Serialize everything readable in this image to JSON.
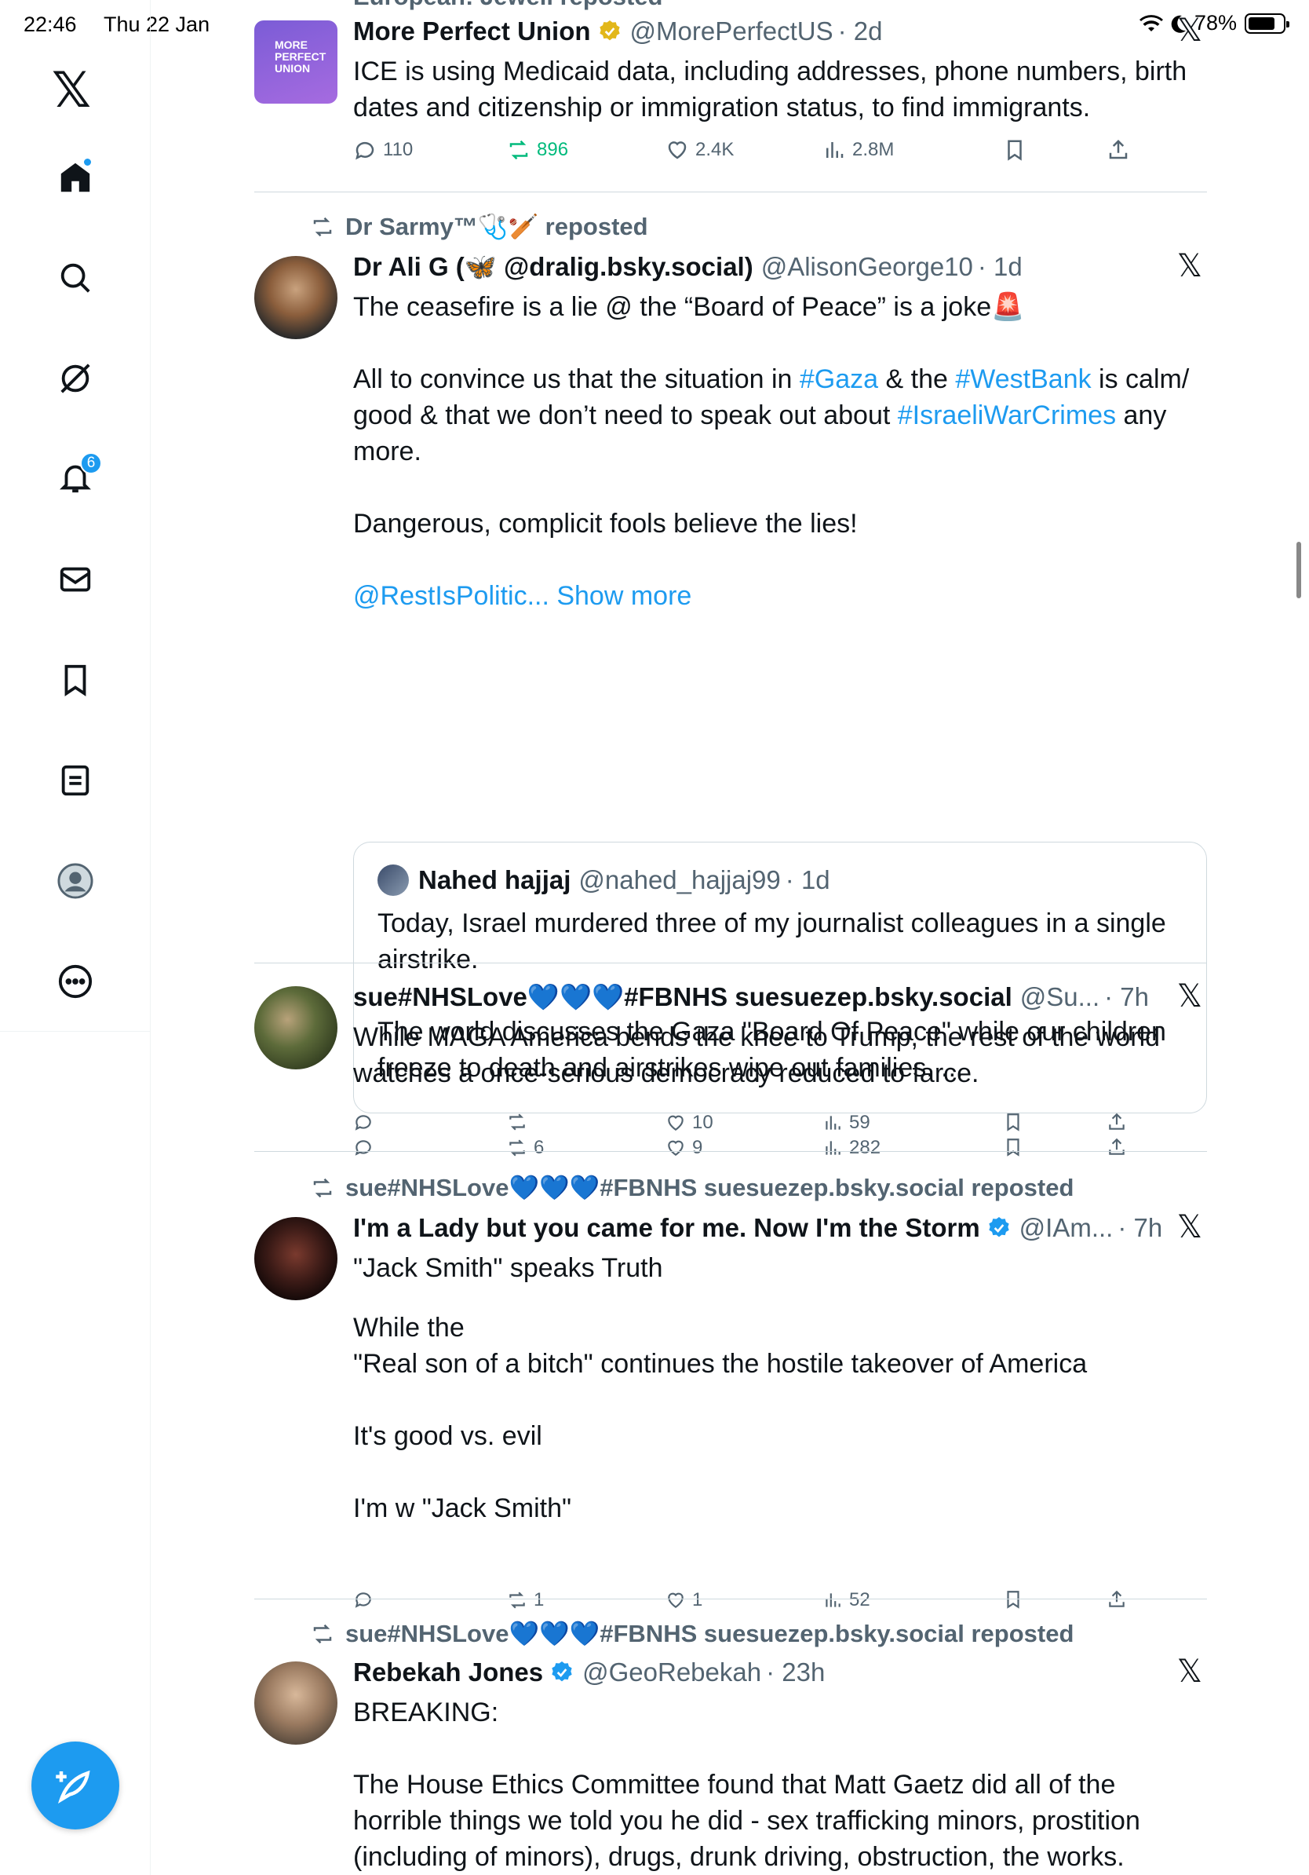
{
  "status": {
    "time": "22:46",
    "date": "Thu 22 Jan",
    "battery": "78%"
  },
  "sidebar": {
    "logo": "𝕏",
    "items": [
      {
        "name": "home",
        "icon": "home-icon"
      },
      {
        "name": "explore",
        "icon": "search-icon"
      },
      {
        "name": "grok",
        "icon": "grok-icon"
      },
      {
        "name": "notifications",
        "icon": "bell-icon",
        "badge": "6"
      },
      {
        "name": "messages",
        "icon": "mail-icon"
      },
      {
        "name": "bookmarks",
        "icon": "bookmark-icon"
      },
      {
        "name": "lists",
        "icon": "list-icon"
      },
      {
        "name": "profile",
        "icon": "avatar-icon"
      },
      {
        "name": "more",
        "icon": "more-icon"
      }
    ],
    "compose": "compose-icon"
  },
  "colors": {
    "accent": "#1d9bf0",
    "text": "#0f1419",
    "muted": "#536471",
    "verified_gold": "#e2b719",
    "repost_green": "#00ba7c"
  },
  "posts": [
    {
      "repost_by": "European: Jewell reposted",
      "name": "More Perfect Union",
      "handle": "@MorePerfectUS",
      "time": "· 2d",
      "avatar_text": "MORE PERFECT UNION",
      "text": "ICE is using Medicaid data, including addresses, phone numbers, birth dates and citizenship or immigration status, to find immigrants.",
      "replies": "110",
      "reposts": "896",
      "likes": "2.4K",
      "views": "2.8M"
    },
    {
      "repost_by": "Dr Sarmy™🩺🏏 reposted",
      "name": "Dr Ali G (🦋 @dralig.bsky.social)",
      "handle": "@AlisonGeorge10",
      "time": "· 1d",
      "text_1": "The ceasefire is a lie @ the “Board of Peace” is a joke🚨",
      "text_2a": "All to convince us that the situation in ",
      "tag_gaza": "#Gaza",
      "text_2b": " & the ",
      "tag_westbank": "#WestBank",
      "text_2c": " is calm/ good & that we don’t need to speak out about ",
      "tag_warcrimes": "#IsraeliWarCrimes",
      "text_2d": " any more.",
      "text_3": "Dangerous, complicit fools believe the lies!",
      "link_text": "@RestIsPolitic... Show more",
      "quote": {
        "name": "Nahed hajjaj",
        "handle": "@nahed_hajjaj99",
        "time": "· 1d",
        "text_1": "Today, Israel murdered three of my journalist colleagues in a single airstrike.",
        "text_2": "The world discusses the Gaza \"Board Of Peace\" while our children freeze to death and airstrikes wipe out families. ..."
      },
      "reposts": "6",
      "likes": "9",
      "views": "282"
    },
    {
      "name": "sue#NHSLove💙💙💙#FBNHS suesuezep.bsky.social",
      "handle": "@Su...",
      "time": "· 7h",
      "text": "While MAGA America bends the knee to Trump, the rest of the world watches a once-serious democracy reduced to farce.",
      "likes": "10",
      "views": "59"
    },
    {
      "repost_by": "sue#NHSLove💙💙💙#FBNHS suesuezep.bsky.social reposted",
      "name": "I'm a Lady but you came for me. Now I'm the Storm",
      "handle": "@IAm...",
      "time": "· 7h",
      "text_1": "\"Jack Smith\" speaks Truth",
      "text_2": "While the\n\"Real son of a bitch\" continues the hostile takeover of America",
      "text_3": "It's good vs. evil",
      "text_4": "I'm w \"Jack Smith\"",
      "reposts": "1",
      "likes": "1",
      "views": "52"
    },
    {
      "repost_by": "sue#NHSLove💙💙💙#FBNHS suesuezep.bsky.social reposted",
      "name": "Rebekah Jones",
      "handle": "@GeoRebekah",
      "time": "· 23h",
      "text_1": "BREAKING:",
      "text_2": "The House Ethics Committee found that Matt Gaetz did all of the horrible things we told you he did - sex trafficking minors, prostition (including of minors), drugs, drunk driving, obstruction, the works."
    }
  ]
}
